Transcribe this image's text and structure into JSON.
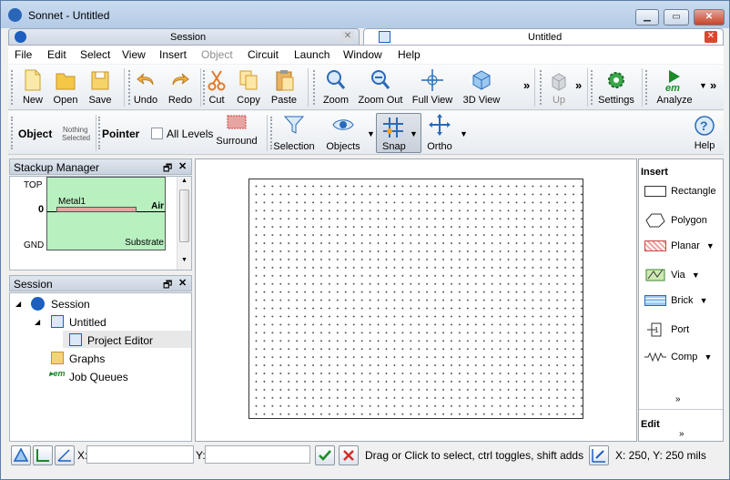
{
  "window": {
    "title": "Sonnet - Untitled"
  },
  "tabs": [
    {
      "label": "Session",
      "close": "✕"
    },
    {
      "label": "Untitled",
      "close": "✕"
    }
  ],
  "menu": [
    "File",
    "Edit",
    "Select",
    "View",
    "Insert",
    "Object",
    "Circuit",
    "Launch",
    "Window",
    "Help"
  ],
  "toolbar": {
    "new": "New",
    "open": "Open",
    "save": "Save",
    "undo": "Undo",
    "redo": "Redo",
    "cut": "Cut",
    "copy": "Copy",
    "paste": "Paste",
    "zoom": "Zoom",
    "zoom_out": "Zoom Out",
    "full_view": "Full View",
    "view3d": "3D View",
    "up": "Up",
    "settings": "Settings",
    "analyze": "Analyze",
    "overflow": "»"
  },
  "toolbar2": {
    "object": "Object",
    "nothing_selected_1": "Nothing",
    "nothing_selected_2": "Selected",
    "pointer": "Pointer",
    "all_levels": "All Levels",
    "surround": "Surround",
    "selection": "Selection",
    "objects": "Objects",
    "snap": "Snap",
    "ortho": "Ortho",
    "help": "Help"
  },
  "stackup": {
    "title": "Stackup Manager",
    "top": "TOP",
    "zero": "0",
    "gnd": "GND",
    "metal": "Metal1",
    "air": "Air",
    "substrate": "Substrate"
  },
  "session": {
    "title": "Session",
    "tree": {
      "session": "Session",
      "untitled": "Untitled",
      "project_editor": "Project Editor",
      "graphs": "Graphs",
      "job_queues": "Job Queues"
    }
  },
  "insert": {
    "title": "Insert",
    "items": [
      "Rectangle",
      "Polygon",
      "Planar",
      "Via",
      "Brick",
      "Port",
      "Comp"
    ],
    "edit": "Edit"
  },
  "status": {
    "x_label": "X:",
    "y_label": "Y:",
    "x_value": "",
    "y_value": "",
    "message": "Drag or Click to select, ctrl toggles, shift adds",
    "coords": "X: 250, Y: 250 mils"
  },
  "colors": {
    "accent": "#1d5fbf",
    "metal": "#e7a4a0",
    "dielectric": "#b8f0c0",
    "analyze": "#1a8a2a"
  }
}
